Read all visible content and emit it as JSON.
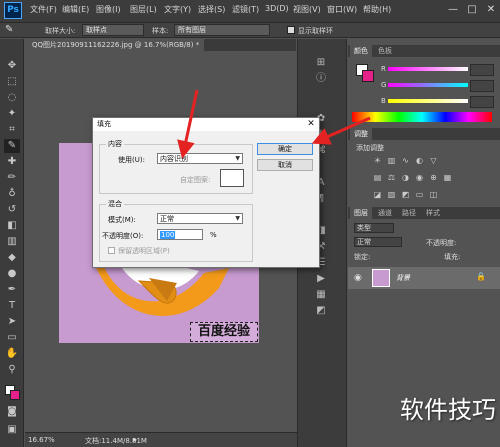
{
  "menubar": {
    "logo": "Ps",
    "items": [
      "文件(F)",
      "编辑(E)",
      "图像(I)",
      "图层(L)",
      "文字(Y)",
      "选择(S)",
      "滤镜(T)",
      "3D(D)",
      "视图(V)",
      "窗口(W)",
      "帮助(H)"
    ],
    "controls": [
      "—",
      "□",
      "✕"
    ]
  },
  "optbar": {
    "size_label": "取样大小:",
    "size_value": "取样点",
    "sample_label": "样本:",
    "sample_value": "所有图层",
    "ring_label": "显示取样环"
  },
  "document": {
    "tab_title": "QQ图片20190911162226.jpg @ 16.7%(RGB/8) *",
    "tab_close": "×",
    "watermark_text": "百度经验"
  },
  "statusbar": {
    "zoom": "16.67%",
    "doc_info": "文档:11.4M/8.81M"
  },
  "panels": {
    "color_tabs": [
      "颜色",
      "色板"
    ],
    "rgb_letters": [
      "R",
      "G",
      "B"
    ],
    "adjust_tab": "调整",
    "adjust_hint": "添加调整",
    "layers_tabs": [
      "图层",
      "通道",
      "路径",
      "样式"
    ],
    "kind_label": "类型",
    "blend_mode": "正常",
    "opacity_label": "不透明度:",
    "lock_label": "锁定:",
    "fill_label": "填充:",
    "layer_name": "背景"
  },
  "dialog": {
    "title": "填充",
    "close": "✕",
    "content_group": "内容",
    "use_label": "使用(U):",
    "use_value": "内容识别",
    "custom_pattern_label": "自定图案:",
    "blend_group": "混合",
    "mode_label": "模式(M):",
    "mode_value": "正常",
    "opacity_label": "不透明度(O):",
    "opacity_value": "100",
    "opacity_unit": "%",
    "preserve_label": "保留透明区域(P)",
    "ok_label": "确定",
    "cancel_label": "取消"
  },
  "bottom_watermark": "软件技巧",
  "colors": {
    "accent_red": "#e52222",
    "canvas_pink": "#c79ad0",
    "ps_blue": "#31a8ff"
  }
}
